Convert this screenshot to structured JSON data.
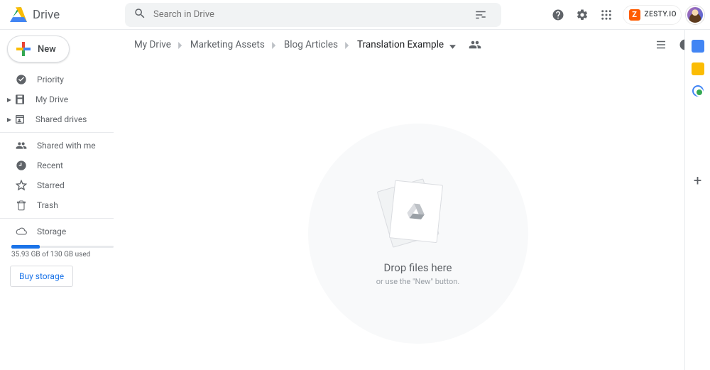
{
  "header": {
    "app_name": "Drive",
    "search_placeholder": "Search in Drive"
  },
  "brand": {
    "name": "ZESTY.IO"
  },
  "new_button": {
    "label": "New"
  },
  "sidebar": {
    "items": [
      {
        "label": "Priority"
      },
      {
        "label": "My Drive"
      },
      {
        "label": "Shared drives"
      },
      {
        "label": "Shared with me"
      },
      {
        "label": "Recent"
      },
      {
        "label": "Starred"
      },
      {
        "label": "Trash"
      },
      {
        "label": "Storage"
      }
    ],
    "storage_text": "35.93 GB of 130 GB used",
    "buy_label": "Buy storage"
  },
  "breadcrumbs": [
    {
      "label": "My Drive"
    },
    {
      "label": "Marketing Assets"
    },
    {
      "label": "Blog Articles"
    },
    {
      "label": "Translation Example"
    }
  ],
  "empty": {
    "line1": "Drop files here",
    "line2": "or use the \"New\" button."
  }
}
